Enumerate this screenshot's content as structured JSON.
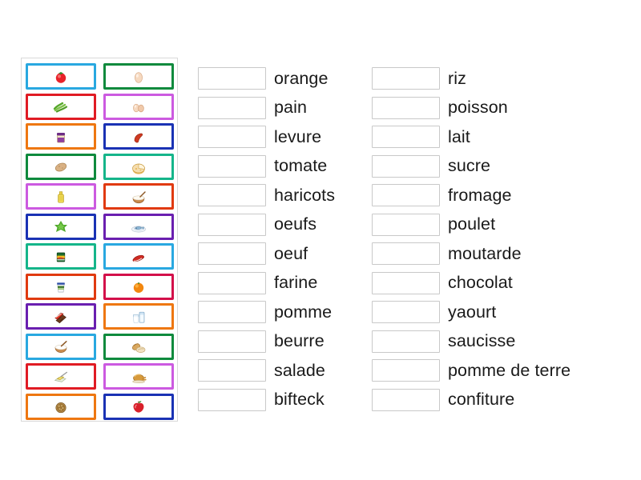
{
  "activity": {
    "type": "match-up-drag-and-drop",
    "language": "fr"
  },
  "tile_panel": {
    "name": "image-tile-panel",
    "tiles": [
      {
        "position": 1,
        "icon": "tomato-icon",
        "label": "tomate",
        "border_color": "#29a8e0"
      },
      {
        "position": 2,
        "icon": "egg-icon",
        "label": "oeuf",
        "border_color": "#0f8a3d"
      },
      {
        "position": 3,
        "icon": "green-beans-icon",
        "label": "haricots",
        "border_color": "#e01b24"
      },
      {
        "position": 4,
        "icon": "eggs-icon",
        "label": "oeufs",
        "border_color": "#cc5ae0"
      },
      {
        "position": 5,
        "icon": "jam-jar-icon",
        "label": "confiture",
        "border_color": "#ee7711"
      },
      {
        "position": 6,
        "icon": "sausage-icon",
        "label": "saucisse",
        "border_color": "#1a32b4"
      },
      {
        "position": 7,
        "icon": "potato-icon",
        "label": "pomme de terre",
        "border_color": "#0f8a3d"
      },
      {
        "position": 8,
        "icon": "cheese-wheel-icon",
        "label": "fromage",
        "border_color": "#15b58a"
      },
      {
        "position": 9,
        "icon": "oil-bottle-icon",
        "label": "levure",
        "border_color": "#cc5ae0"
      },
      {
        "position": 10,
        "icon": "flour-bowl-icon",
        "label": "farine",
        "border_color": "#e03a10"
      },
      {
        "position": 11,
        "icon": "salad-leaves-icon",
        "label": "salade",
        "border_color": "#1a32b4"
      },
      {
        "position": 12,
        "icon": "fish-plate-icon",
        "label": "poisson",
        "border_color": "#6a1fb0"
      },
      {
        "position": 13,
        "icon": "mustard-pack-icon",
        "label": "moutarde",
        "border_color": "#15b58a"
      },
      {
        "position": 14,
        "icon": "steak-icon",
        "label": "bifteck",
        "border_color": "#29a8e0"
      },
      {
        "position": 15,
        "icon": "yogurt-pot-icon",
        "label": "yaourt",
        "border_color": "#e03a10"
      },
      {
        "position": 16,
        "icon": "orange-icon",
        "label": "orange",
        "border_color": "#d3104a"
      },
      {
        "position": 17,
        "icon": "chocolate-bar-icon",
        "label": "chocolat",
        "border_color": "#6a1fb0"
      },
      {
        "position": 18,
        "icon": "milk-glass-icon",
        "label": "lait",
        "border_color": "#ee7711"
      },
      {
        "position": 19,
        "icon": "sugar-bowl-icon",
        "label": "sucre",
        "border_color": "#29a8e0"
      },
      {
        "position": 20,
        "icon": "bread-icon",
        "label": "pain",
        "border_color": "#0f8a3d"
      },
      {
        "position": 21,
        "icon": "butter-icon",
        "label": "beurre",
        "border_color": "#e01b24"
      },
      {
        "position": 22,
        "icon": "roast-chicken-icon",
        "label": "poulet",
        "border_color": "#cc5ae0"
      },
      {
        "position": 23,
        "icon": "rice-bowl-icon",
        "label": "riz",
        "border_color": "#ee7711"
      },
      {
        "position": 24,
        "icon": "apple-icon",
        "label": "pomme",
        "border_color": "#1a32b4"
      }
    ]
  },
  "word_columns": [
    {
      "name": "word-column-left",
      "rows": [
        {
          "word": "orange",
          "answer": ""
        },
        {
          "word": "pain",
          "answer": ""
        },
        {
          "word": "levure",
          "answer": ""
        },
        {
          "word": "tomate",
          "answer": ""
        },
        {
          "word": "haricots",
          "answer": ""
        },
        {
          "word": "oeufs",
          "answer": ""
        },
        {
          "word": "oeuf",
          "answer": ""
        },
        {
          "word": "farine",
          "answer": ""
        },
        {
          "word": "pomme",
          "answer": ""
        },
        {
          "word": "beurre",
          "answer": ""
        },
        {
          "word": "salade",
          "answer": ""
        },
        {
          "word": "bifteck",
          "answer": ""
        }
      ]
    },
    {
      "name": "word-column-right",
      "rows": [
        {
          "word": "riz",
          "answer": ""
        },
        {
          "word": "poisson",
          "answer": ""
        },
        {
          "word": "lait",
          "answer": ""
        },
        {
          "word": "sucre",
          "answer": ""
        },
        {
          "word": "fromage",
          "answer": ""
        },
        {
          "word": "poulet",
          "answer": ""
        },
        {
          "word": "moutarde",
          "answer": ""
        },
        {
          "word": "chocolat",
          "answer": ""
        },
        {
          "word": "yaourt",
          "answer": ""
        },
        {
          "word": "saucisse",
          "answer": ""
        },
        {
          "word": "pomme de terre",
          "answer": ""
        },
        {
          "word": "confiture",
          "answer": ""
        }
      ]
    }
  ],
  "colors": {
    "page_background": "#ffffff",
    "panel_border": "#d8d8d8",
    "drop_box_border": "#c9c9c9",
    "word_text": "#1a1a1a"
  }
}
